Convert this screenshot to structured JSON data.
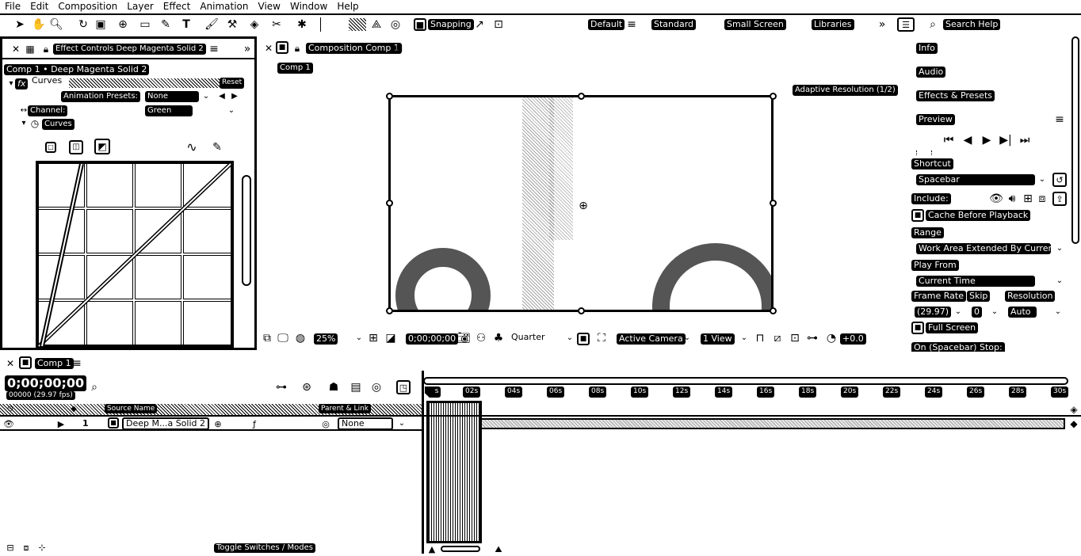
{
  "menu": [
    "File",
    "Edit",
    "Composition",
    "Layer",
    "Effect",
    "Animation",
    "View",
    "Window",
    "Help"
  ],
  "toolbar": {
    "snapping": "Snapping",
    "workspaces": [
      "Default",
      "Standard",
      "Small Screen",
      "Libraries"
    ],
    "search_help": "Search Help"
  },
  "effect_controls": {
    "tab_title": "Effect Controls Deep Magenta Solid 2",
    "layer_path": "Comp 1 • Deep Magenta Solid 2",
    "effect_name": "Curves",
    "reset": "Reset",
    "animation_presets_label": "Animation Presets:",
    "animation_presets_value": "None",
    "channel_label": "Channel:",
    "channel_value": "Green",
    "curves_label": "Curves"
  },
  "composition": {
    "tab_title": "Composition Comp 1",
    "breadcrumb": "Comp 1",
    "adaptive_resolution": "Adaptive Resolution (1/2)",
    "zoom": "25%",
    "timecode": "0;00;00;00",
    "resolution": "Quarter",
    "camera": "Active Camera",
    "views": "1 View",
    "exposure": "+0.0"
  },
  "right_panels": {
    "info": "Info",
    "audio": "Audio",
    "effects_presets": "Effects & Presets",
    "preview": "Preview",
    "shortcut_label": "Shortcut",
    "shortcut_value": "Spacebar",
    "include_label": "Include:",
    "cache_before_playback": "Cache Before Playback",
    "range_label": "Range",
    "range_value": "Work Area Extended By Current...",
    "play_from_label": "Play From",
    "play_from_value": "Current Time",
    "frame_rate_label": "Frame Rate",
    "skip_label": "Skip",
    "resolution_label": "Resolution",
    "frame_rate_value": "(29.97)",
    "skip_value": "0",
    "resolution_value": "Auto",
    "full_screen": "Full Screen",
    "on_spacebar_stop": "On (Spacebar) Stop:"
  },
  "timeline": {
    "tab_title": "Comp 1",
    "timecode": "0;00;00;00",
    "frame_info": "00000 (29.97 fps)",
    "source_name_header": "Source Name",
    "parent_header": "Parent & Link",
    "ruler": [
      "0s",
      "02s",
      "04s",
      "06s",
      "08s",
      "10s",
      "12s",
      "14s",
      "16s",
      "18s",
      "20s",
      "22s",
      "24s",
      "26s",
      "28s",
      "30s"
    ],
    "layer": {
      "number": "1",
      "name": "Deep M...a Solid 2",
      "parent": "None"
    },
    "toggle_switches": "Toggle Switches / Modes"
  }
}
